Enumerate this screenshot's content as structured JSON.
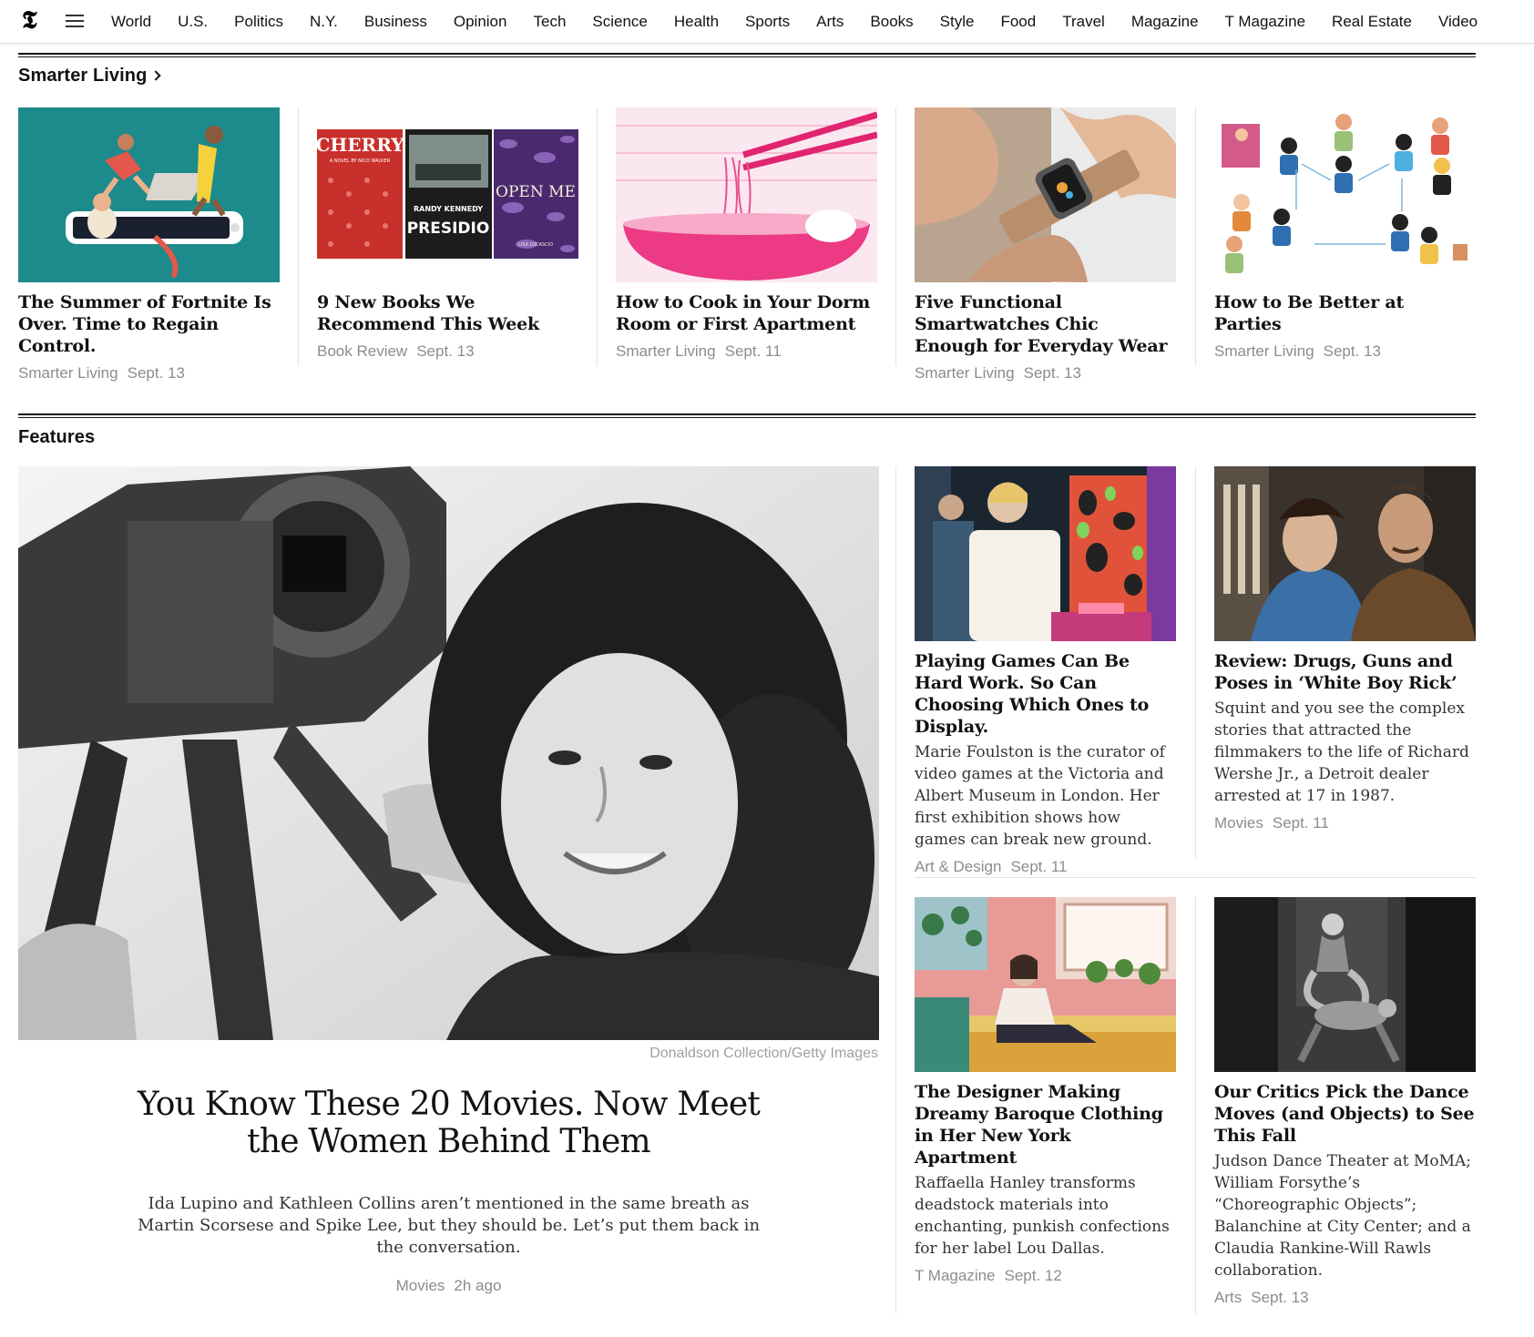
{
  "nav": {
    "logo": "𝕿",
    "links": [
      "World",
      "U.S.",
      "Politics",
      "N.Y.",
      "Business",
      "Opinion",
      "Tech",
      "Science",
      "Health",
      "Sports",
      "Arts",
      "Books",
      "Style",
      "Food",
      "Travel",
      "Magazine",
      "T Magazine",
      "Real Estate",
      "Video"
    ]
  },
  "smarter_living": {
    "title": "Smarter Living",
    "cards": [
      {
        "headline": "The Summer of Fortnite Is Over. Time to Regain Control.",
        "section": "Smarter Living",
        "date": "Sept. 13",
        "image": "fortnite-illustration"
      },
      {
        "headline": "9 New Books We Recommend This Week",
        "section": "Book Review",
        "date": "Sept. 13",
        "image": "book-covers",
        "covers": [
          "CHERRY",
          "PRESIDIO",
          "OPEN ME"
        ],
        "cover_subtitles": [
          "A NOVEL BY NICO WALKER",
          "RANDY KENNEDY",
          "LISA LOCASCIO"
        ]
      },
      {
        "headline": "How to Cook in Your Dorm Room or First Apartment",
        "section": "Smarter Living",
        "date": "Sept. 11",
        "image": "noodle-bowl-illustration"
      },
      {
        "headline": "Five Functional Smartwatches Chic Enough for Everyday Wear",
        "section": "Smarter Living",
        "date": "Sept. 13",
        "image": "smartwatch-photo"
      },
      {
        "headline": "How to Be Better at Parties",
        "section": "Smarter Living",
        "date": "Sept. 13",
        "image": "party-people-illustration"
      }
    ]
  },
  "features": {
    "title": "Features",
    "lead": {
      "headline": "You Know These 20 Movies. Now Meet the Women Behind Them",
      "summary": "Ida Lupino and Kathleen Collins aren’t mentioned in the same breath as Martin Scorsese and Spike Lee, but they should be. Let’s put them back in the conversation.",
      "credit": "Donaldson Collection/Getty Images",
      "section": "Movies",
      "date": "2h ago"
    },
    "cards": [
      {
        "headline": "Playing Games Can Be Hard Work. So Can Choosing Which Ones to Display.",
        "summary": "Marie Foulston is the curator of video games at the Victoria and Albert Museum in London. Her first exhibition shows how games can break new ground.",
        "section": "Art & Design",
        "date": "Sept. 11"
      },
      {
        "headline": "Review: Drugs, Guns and Poses in ‘White Boy Rick’",
        "summary": "Squint and you see the complex stories that attracted the filmmakers to the life of Richard Wershe Jr., a Detroit dealer arrested at 17 in 1987.",
        "section": "Movies",
        "date": "Sept. 11"
      },
      {
        "headline": "The Designer Making Dreamy Baroque Clothing in Her New York Apartment",
        "summary": "Raffaella Hanley transforms deadstock materials into enchanting, punkish confections for her label Lou Dallas.",
        "section": "T Magazine",
        "date": "Sept. 12"
      },
      {
        "headline": "Our Critics Pick the Dance Moves (and Objects) to See This Fall",
        "summary": "Judson Dance Theater at MoMA; William Forsythe’s “Choreographic Objects”; Balanchine at City Center; and a Claudia Rankine-Will Rawls collaboration.",
        "section": "Arts",
        "date": "Sept. 13"
      }
    ]
  },
  "colors": {
    "text": "#121212",
    "meta": "#8c8c8c",
    "rule": "#121212",
    "divider": "#e2e2e2"
  }
}
